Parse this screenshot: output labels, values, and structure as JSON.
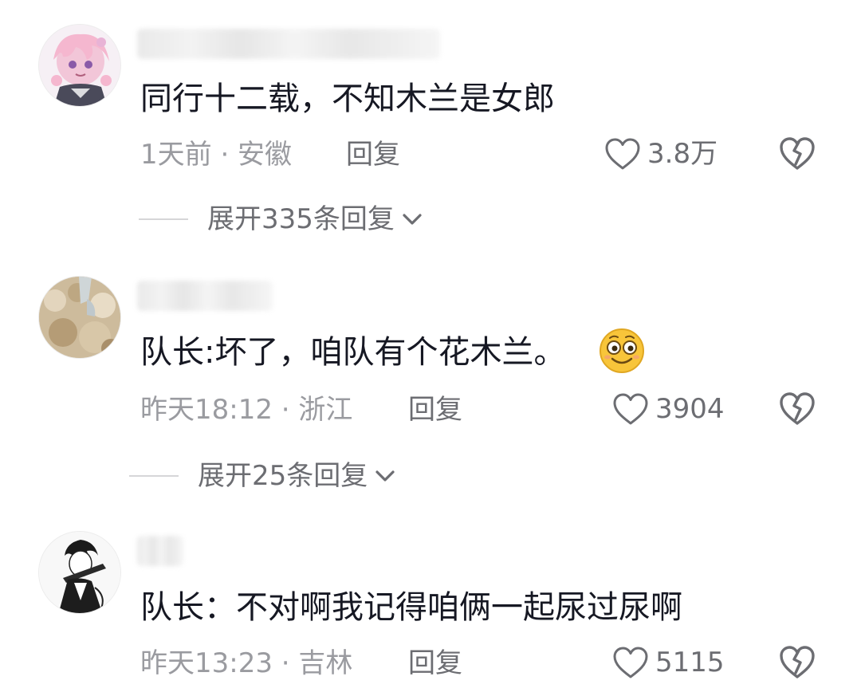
{
  "colors": {
    "text_primary": "#161823",
    "text_meta": "#9a9ba0",
    "text_action": "#6c6d72",
    "background": "#ffffff"
  },
  "icons": {
    "like": "heart-outline-icon",
    "dislike": "broken-heart-icon",
    "expand": "chevron-down-icon",
    "emoji": "smiling-face-emoji"
  },
  "comments": [
    {
      "text": "同行十二载，不知木兰是女郎",
      "meta": "1天前 · 安徽",
      "reply_label": "回复",
      "likes": "3.8万",
      "expand_label": "展开335条回复"
    },
    {
      "text": "队长:坏了，咱队有个花木兰。",
      "meta": "昨天18:12 · 浙江",
      "reply_label": "回复",
      "likes": "3904",
      "expand_label": "展开25条回复"
    },
    {
      "text": "队长：不对啊我记得咱俩一起尿过尿啊",
      "meta": "昨天13:23 · 吉林",
      "reply_label": "回复",
      "likes": "5115"
    }
  ]
}
